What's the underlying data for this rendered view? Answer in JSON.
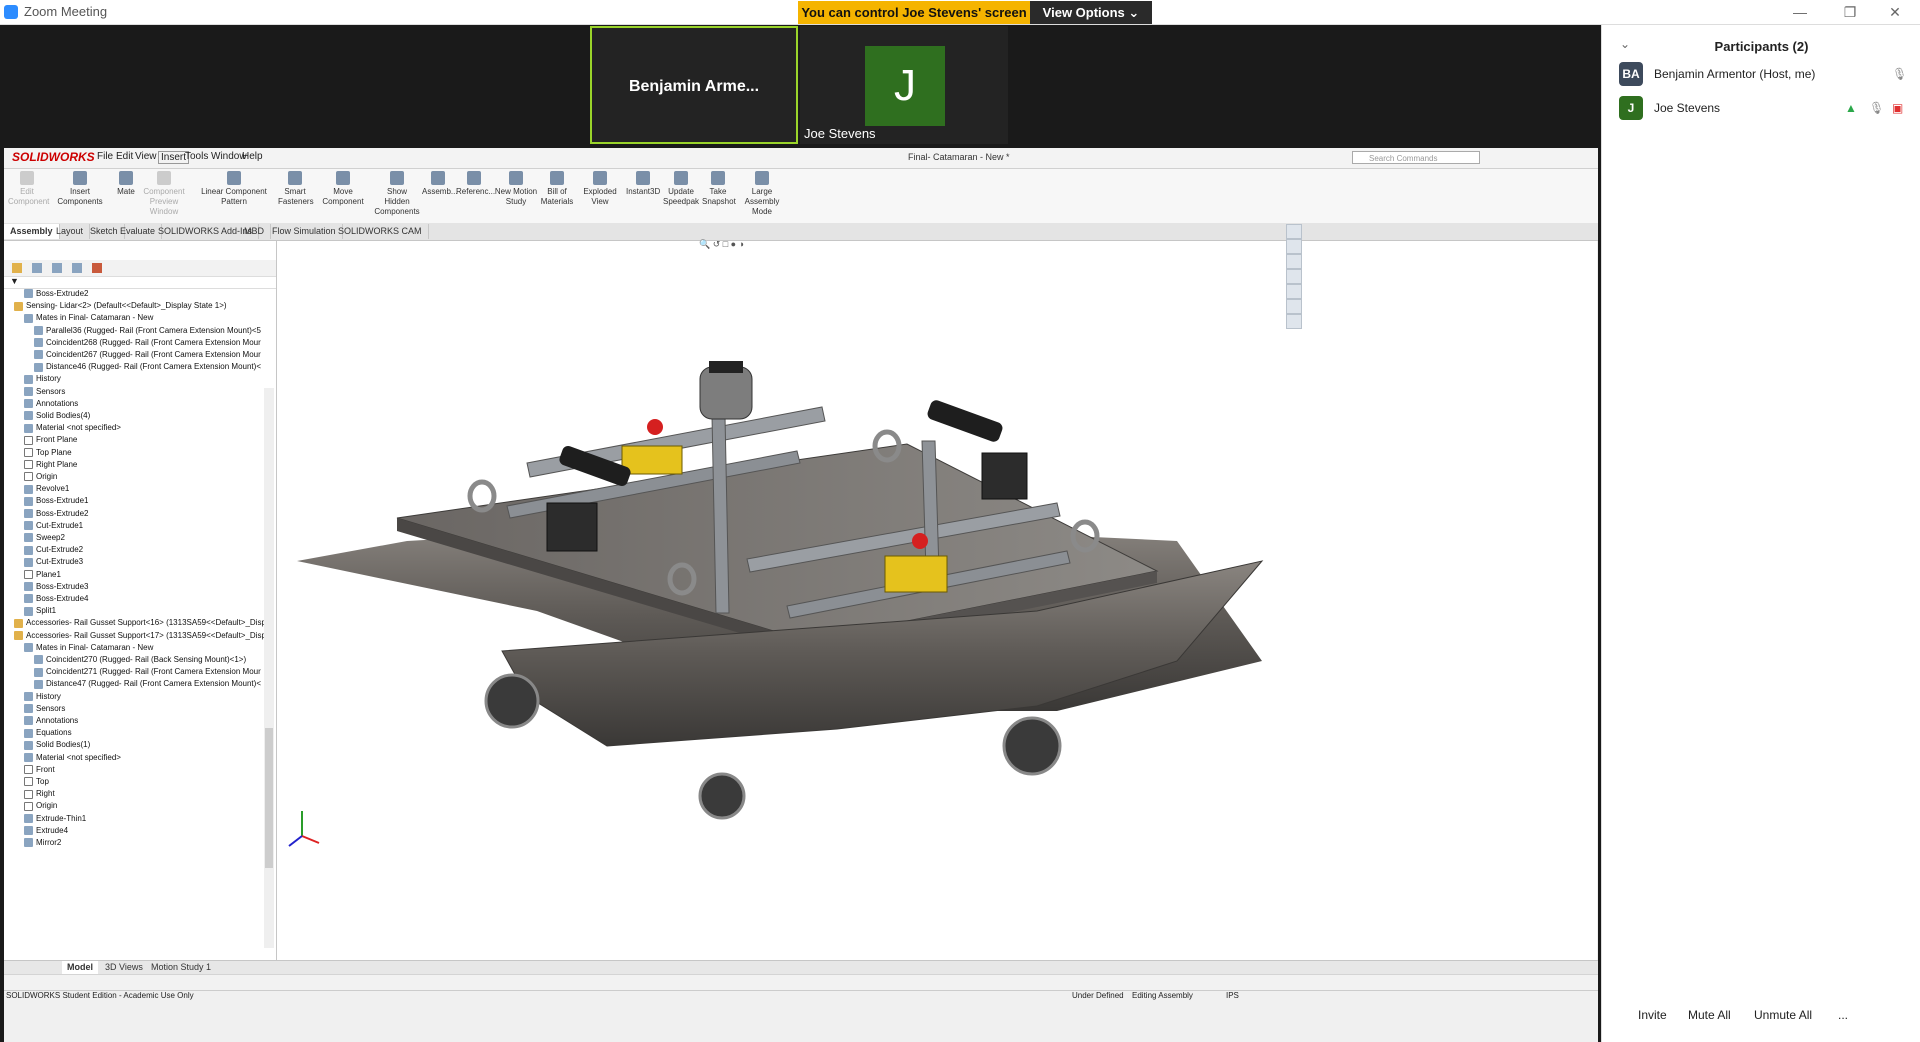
{
  "window": {
    "title": "Zoom Meeting"
  },
  "banner": {
    "control_text": "You can control Joe Stevens' screen",
    "view_options": "View Options"
  },
  "video": {
    "tile1_name": "Benjamin Arme...",
    "tile2_initial": "J",
    "tile2_name": "Joe Stevens"
  },
  "sw": {
    "logo": "SOLIDWORKS",
    "menu": [
      "File",
      "Edit",
      "View",
      "Insert",
      "Tools",
      "Window",
      "Help"
    ],
    "doc_title": "Final- Catamaran - New *",
    "search_placeholder": "Search Commands",
    "ribbon": [
      {
        "label": "Edit Component",
        "disabled": true
      },
      {
        "label": "Insert Components",
        "disabled": false
      },
      {
        "label": "Mate",
        "disabled": false
      },
      {
        "label": "Component Preview Window",
        "disabled": true
      },
      {
        "label": "Linear Component Pattern",
        "disabled": false
      },
      {
        "label": "Smart Fasteners",
        "disabled": false
      },
      {
        "label": "Move Component",
        "disabled": false
      },
      {
        "label": "Show Hidden Components",
        "disabled": false
      },
      {
        "label": "Assemb...",
        "disabled": false
      },
      {
        "label": "Referenc...",
        "disabled": false
      },
      {
        "label": "New Motion Study",
        "disabled": false
      },
      {
        "label": "Bill of Materials",
        "disabled": false
      },
      {
        "label": "Exploded View",
        "disabled": false
      },
      {
        "label": "Instant3D",
        "disabled": false
      },
      {
        "label": "Update Speedpak",
        "disabled": false
      },
      {
        "label": "Take Snapshot",
        "disabled": false
      },
      {
        "label": "Large Assembly Mode",
        "disabled": false
      }
    ],
    "tabs": [
      "Assembly",
      "Layout",
      "Sketch",
      "Evaluate",
      "SOLIDWORKS Add-Ins",
      "MBD",
      "Flow Simulation",
      "SOLIDWORKS CAM"
    ],
    "active_tab": "Assembly",
    "tree": [
      {
        "label": "Boss-Extrude2",
        "indent": 1,
        "icon": "feature"
      },
      {
        "label": "Sensing- Lidar<2> (Default<<Default>_Display State 1>)",
        "indent": 0,
        "icon": "part"
      },
      {
        "label": "Mates in Final- Catamaran - New",
        "indent": 1,
        "icon": "mates"
      },
      {
        "label": "Parallel36 (Rugged- Rail (Front Camera Extension Mount)<5",
        "indent": 2,
        "icon": "mate"
      },
      {
        "label": "Coincident268 (Rugged- Rail (Front Camera Extension Mour",
        "indent": 2,
        "icon": "mate"
      },
      {
        "label": "Coincident267 (Rugged- Rail (Front Camera Extension Mour",
        "indent": 2,
        "icon": "mate"
      },
      {
        "label": "Distance46 (Rugged- Rail (Front Camera Extension Mount)<",
        "indent": 2,
        "icon": "mate"
      },
      {
        "label": "History",
        "indent": 1,
        "icon": "feature"
      },
      {
        "label": "Sensors",
        "indent": 1,
        "icon": "feature"
      },
      {
        "label": "Annotations",
        "indent": 1,
        "icon": "feature"
      },
      {
        "label": "Solid Bodies(4)",
        "indent": 1,
        "icon": "feature"
      },
      {
        "label": "Material <not specified>",
        "indent": 1,
        "icon": "feature"
      },
      {
        "label": "Front Plane",
        "indent": 1,
        "icon": "plane"
      },
      {
        "label": "Top Plane",
        "indent": 1,
        "icon": "plane"
      },
      {
        "label": "Right Plane",
        "indent": 1,
        "icon": "plane"
      },
      {
        "label": "Origin",
        "indent": 1,
        "icon": "plane"
      },
      {
        "label": "Revolve1",
        "indent": 1,
        "icon": "feature"
      },
      {
        "label": "Boss-Extrude1",
        "indent": 1,
        "icon": "feature"
      },
      {
        "label": "Boss-Extrude2",
        "indent": 1,
        "icon": "feature"
      },
      {
        "label": "Cut-Extrude1",
        "indent": 1,
        "icon": "feature"
      },
      {
        "label": "Sweep2",
        "indent": 1,
        "icon": "feature"
      },
      {
        "label": "Cut-Extrude2",
        "indent": 1,
        "icon": "feature"
      },
      {
        "label": "Cut-Extrude3",
        "indent": 1,
        "icon": "feature"
      },
      {
        "label": "Plane1",
        "indent": 1,
        "icon": "plane"
      },
      {
        "label": "Boss-Extrude3",
        "indent": 1,
        "icon": "feature"
      },
      {
        "label": "Boss-Extrude4",
        "indent": 1,
        "icon": "feature"
      },
      {
        "label": "Split1",
        "indent": 1,
        "icon": "feature"
      },
      {
        "label": "Accessories- Rail Gusset Support<16> (1313SA59<<Default>_Disp",
        "indent": 0,
        "icon": "part"
      },
      {
        "label": "Accessories- Rail Gusset Support<17> (1313SA59<<Default>_Disp",
        "indent": 0,
        "icon": "part"
      },
      {
        "label": "Mates in Final- Catamaran - New",
        "indent": 1,
        "icon": "mates"
      },
      {
        "label": "Coincident270 (Rugged- Rail (Back Sensing Mount)<1>)",
        "indent": 2,
        "icon": "mate"
      },
      {
        "label": "Coincident271 (Rugged- Rail (Front Camera Extension Mour",
        "indent": 2,
        "icon": "mate"
      },
      {
        "label": "Distance47 (Rugged- Rail (Front Camera Extension Mount)<",
        "indent": 2,
        "icon": "mate"
      },
      {
        "label": "History",
        "indent": 1,
        "icon": "feature"
      },
      {
        "label": "Sensors",
        "indent": 1,
        "icon": "feature"
      },
      {
        "label": "Annotations",
        "indent": 1,
        "icon": "feature"
      },
      {
        "label": "Equations",
        "indent": 1,
        "icon": "feature"
      },
      {
        "label": "Solid Bodies(1)",
        "indent": 1,
        "icon": "feature"
      },
      {
        "label": "Material <not specified>",
        "indent": 1,
        "icon": "feature"
      },
      {
        "label": "Front",
        "indent": 1,
        "icon": "plane"
      },
      {
        "label": "Top",
        "indent": 1,
        "icon": "plane"
      },
      {
        "label": "Right",
        "indent": 1,
        "icon": "plane"
      },
      {
        "label": "Origin",
        "indent": 1,
        "icon": "plane"
      },
      {
        "label": "Extrude-Thin1",
        "indent": 1,
        "icon": "feature"
      },
      {
        "label": "Extrude4",
        "indent": 1,
        "icon": "feature"
      },
      {
        "label": "Mirror2",
        "indent": 1,
        "icon": "feature"
      }
    ],
    "bottom_tabs": [
      "Model",
      "3D Views",
      "Motion Study 1"
    ],
    "active_bottom_tab": "Model",
    "status_left": "SOLIDWORKS Student Edition - Academic Use Only",
    "status_underdefined": "Under Defined",
    "status_editing": "Editing Assembly",
    "status_units": "IPS"
  },
  "participants": {
    "header": "Participants (2)",
    "list": [
      {
        "initials": "BA",
        "name": "Benjamin Armentor (Host, me)",
        "color": "#3d4a5c"
      },
      {
        "initials": "J",
        "name": "Joe Stevens",
        "color": "#2f6f1f"
      }
    ],
    "buttons": [
      "Invite",
      "Mute All",
      "Unmute All",
      "..."
    ]
  },
  "colors": {
    "banner": "#f5b400",
    "zoom_blue": "#2d8cff",
    "active_speaker": "#9ad42a"
  }
}
